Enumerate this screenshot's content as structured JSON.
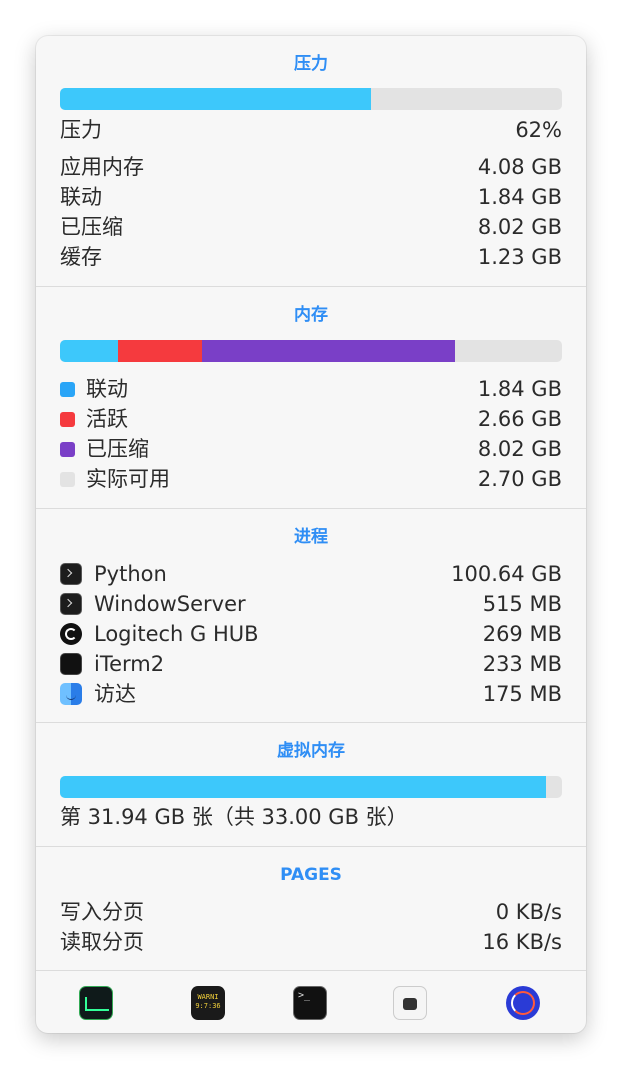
{
  "pressure": {
    "title": "压力",
    "percent": 62,
    "label": "压力",
    "value": "62%",
    "rows": [
      {
        "label": "应用内存",
        "value": "4.08 GB"
      },
      {
        "label": "联动",
        "value": "1.84 GB"
      },
      {
        "label": "已压缩",
        "value": "8.02 GB"
      },
      {
        "label": "缓存",
        "value": "1.23 GB"
      }
    ]
  },
  "memory": {
    "title": "内存",
    "segments": [
      {
        "name": "wired",
        "fraction": 0.115,
        "color": "#3dc8fb"
      },
      {
        "name": "active",
        "fraction": 0.168,
        "color": "#f53a3e"
      },
      {
        "name": "compressed",
        "fraction": 0.503,
        "color": "#7a3fc7"
      }
    ],
    "legend": [
      {
        "label": "联动",
        "value": "1.84 GB",
        "color": "#2aa5f7"
      },
      {
        "label": "活跃",
        "value": "2.66 GB",
        "color": "#f53a3e"
      },
      {
        "label": "已压缩",
        "value": "8.02 GB",
        "color": "#7a3fc7"
      },
      {
        "label": "实际可用",
        "value": "2.70 GB",
        "color": "#e3e3e3"
      }
    ]
  },
  "processes": {
    "title": "进程",
    "items": [
      {
        "name": "Python",
        "value": "100.64 GB",
        "icon": "terminal-icon"
      },
      {
        "name": "WindowServer",
        "value": "515 MB",
        "icon": "terminal-icon"
      },
      {
        "name": "Logitech G HUB",
        "value": "269 MB",
        "icon": "logitech-icon"
      },
      {
        "name": "iTerm2",
        "value": "233 MB",
        "icon": "iterm-icon"
      },
      {
        "name": "访达",
        "value": "175 MB",
        "icon": "finder-icon"
      }
    ]
  },
  "swap": {
    "title": "虚拟内存",
    "fraction": 0.968,
    "text": "第 31.94 GB 张（共 33.00 GB 张）"
  },
  "pages": {
    "title": "PAGES",
    "rows": [
      {
        "label": "写入分页",
        "value": "0 KB/s"
      },
      {
        "label": "读取分页",
        "value": "16 KB/s"
      }
    ]
  },
  "dock": {
    "items": [
      {
        "name": "activity-monitor-icon"
      },
      {
        "name": "console-icon",
        "text": "WARNI\n9:7:36"
      },
      {
        "name": "terminal-app-icon",
        "text": ">_"
      },
      {
        "name": "network-icon"
      },
      {
        "name": "disk-utility-icon"
      }
    ]
  },
  "colors": {
    "accent": "#2f8ef5",
    "bar_fill": "#3dc8fb",
    "bar_track": "#e3e3e3"
  }
}
